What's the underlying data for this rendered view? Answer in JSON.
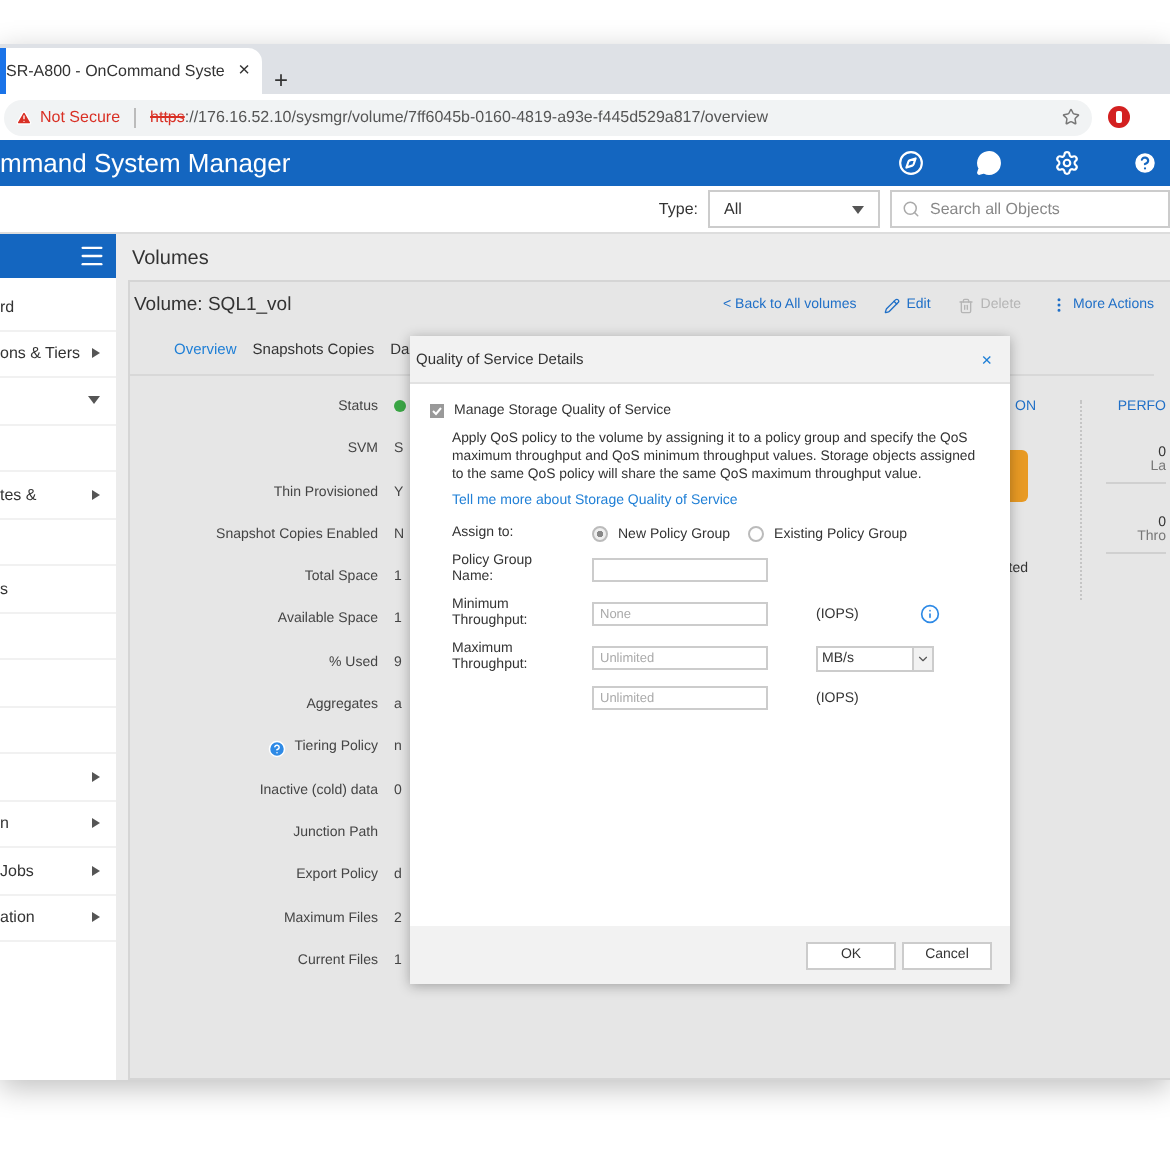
{
  "browser": {
    "tab": {
      "title": "SR-A800 - OnCommand Syste",
      "close": "×"
    },
    "new_tab": "+",
    "security": "Not Secure",
    "url_scheme": "https",
    "url_rest": "://176.16.52.10/sysmgr/volume/7ff6045b-0160-4819-a93e-f445d529a817/overview"
  },
  "app_header": {
    "title": "mmand System Manager"
  },
  "filter": {
    "type_label": "Type:",
    "type_value": "All",
    "search_placeholder": "Search all Objects"
  },
  "sidebar": {
    "items": [
      {
        "label": "rd",
        "submenu": false
      },
      {
        "label": "ons & Tiers",
        "submenu": true,
        "expanded": false
      },
      {
        "submenu": true,
        "expanded": true
      },
      {
        "submenu": false
      },
      {
        "label": "tes &",
        "submenu": true,
        "expanded": false
      },
      {
        "submenu": false
      },
      {
        "label": "s",
        "submenu": false
      },
      {
        "submenu": false
      },
      {
        "submenu": false
      },
      {
        "submenu": false
      },
      {
        "submenu": true,
        "expanded": false
      },
      {
        "label": "n",
        "submenu": true,
        "expanded": false
      },
      {
        "label": "Jobs",
        "submenu": true,
        "expanded": false
      },
      {
        "label": "ation",
        "submenu": true,
        "expanded": false
      }
    ]
  },
  "page": {
    "title": "Volumes",
    "volume_title": "Volume: SQL1_vol",
    "back_link": "< Back to All volumes",
    "actions": [
      {
        "label": "Edit",
        "kind": "edit",
        "disabled": false
      },
      {
        "label": "Delete",
        "kind": "delete",
        "disabled": true
      },
      {
        "label": "More Actions",
        "kind": "more",
        "disabled": false
      }
    ],
    "tabs": [
      {
        "label": "Overview",
        "selected": true
      },
      {
        "label": "Snapshots Copies",
        "selected": false
      },
      {
        "label": "Da",
        "selected": false
      }
    ],
    "details": [
      {
        "label": "Status",
        "kind": "status",
        "help": false
      },
      {
        "label": "SVM",
        "value": "S",
        "kind": "text",
        "help": false
      },
      {
        "label": "Thin Provisioned",
        "value": "Y",
        "kind": "text",
        "help": false
      },
      {
        "label": "Snapshot Copies Enabled",
        "value": "N",
        "kind": "text",
        "help": false
      },
      {
        "label": "Total Space",
        "value": "1",
        "kind": "text",
        "help": false
      },
      {
        "label": "Available Space",
        "value": "1",
        "kind": "text",
        "help": false
      },
      {
        "label": "% Used",
        "value": "9",
        "kind": "text",
        "help": false
      },
      {
        "label": "Aggregates",
        "value": "a",
        "kind": "text",
        "help": false
      },
      {
        "label": "Tiering Policy",
        "value": "n",
        "kind": "text",
        "help": true
      },
      {
        "label": "Inactive (cold) data",
        "value": "0",
        "kind": "text",
        "help": false
      },
      {
        "label": "Junction Path",
        "kind": "text",
        "help": false
      },
      {
        "label": "Export Policy",
        "value": "d",
        "kind": "text",
        "help": false
      },
      {
        "label": "Maximum Files",
        "value": "2",
        "kind": "text",
        "help": false
      },
      {
        "label": "Current Files",
        "value": "1",
        "kind": "text",
        "help": false
      }
    ],
    "protection": {
      "heading": "ON",
      "status": "ted"
    },
    "performance": {
      "heading": "PERFO",
      "metrics": [
        {
          "value": "0",
          "label": "La"
        },
        {
          "value": "0",
          "label": "Thro"
        }
      ]
    }
  },
  "dialog": {
    "title": "Quality of Service Details",
    "close": "×",
    "manage": {
      "label": "Manage Storage Quality of Service",
      "checked": true
    },
    "description": "Apply QoS policy to the volume by assigning it to a policy group and specify the QoS maximum throughput and QoS minimum throughput values. Storage objects assigned to the same QoS policy will share the same QoS maximum throughput value.",
    "link": "Tell me more about Storage Quality of Service",
    "assign": {
      "label": "Assign to:",
      "options": [
        {
          "label": "New Policy Group",
          "selected": true
        },
        {
          "label": "Existing Policy Group",
          "selected": false
        }
      ]
    },
    "fields": [
      {
        "label": "Policy Group Name:"
      },
      {
        "label": "Minimum Throughput:",
        "placeholder": "None",
        "unit": "(IOPS)",
        "info": true
      },
      {
        "label": "Maximum Throughput:",
        "placeholder": "Unlimited",
        "unit_select": "MB/s"
      },
      {
        "placeholder": "Unlimited",
        "unit": "(IOPS)"
      }
    ],
    "buttons": [
      "OK",
      "Cancel"
    ]
  }
}
